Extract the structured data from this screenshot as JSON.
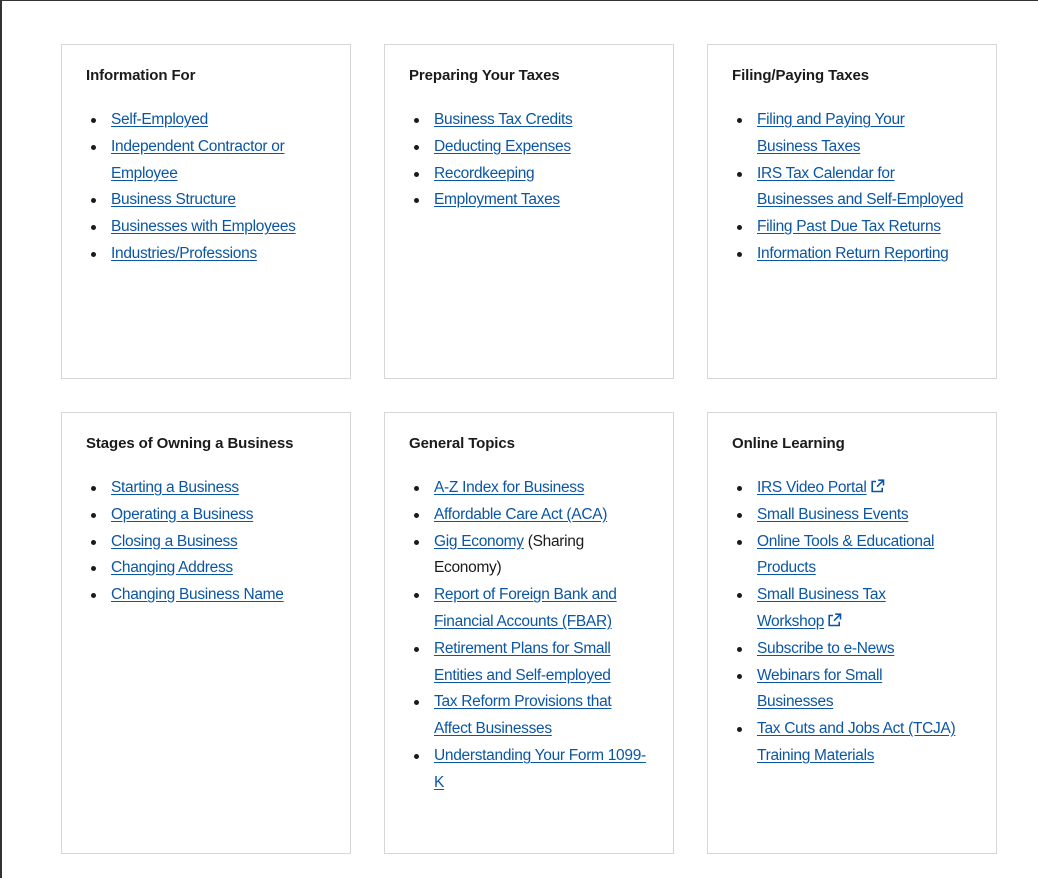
{
  "cards": [
    {
      "title": "Information For",
      "links": [
        "Self-Employed",
        "Independent Contractor or Employee",
        "Business Structure",
        "Businesses with Employees",
        "Industries/Professions"
      ]
    },
    {
      "title": "Preparing Your Taxes",
      "links": [
        "Business Tax Credits",
        "Deducting Expenses",
        "Recordkeeping",
        "Employment Taxes"
      ]
    },
    {
      "title": "Filing/Paying Taxes",
      "links": [
        "Filing and Paying Your Business Taxes",
        "IRS Tax Calendar for Businesses and Self-Employed",
        "Filing Past Due Tax Returns",
        "Information Return Reporting"
      ]
    },
    {
      "title": "Stages of Owning a Business",
      "links": [
        "Starting a Business",
        "Operating a Business",
        "Closing a Business",
        "Changing Address",
        "Changing Business Name"
      ]
    },
    {
      "title": "General Topics",
      "links": [
        "A-Z Index for Business",
        "Affordable Care Act (ACA)",
        "Gig Economy",
        "Report of Foreign Bank and Financial Accounts (FBAR)",
        "Retirement Plans for Small Entities and Self-employed",
        "Tax Reform Provisions that Affect Businesses",
        "Understanding Your Form 1099-K"
      ],
      "gig_suffix": " (Sharing Economy)"
    },
    {
      "title": "Online Learning",
      "links": [
        "IRS Video Portal",
        "Small Business Events",
        "Online Tools & Educational Products",
        "Small Business Tax Workshop",
        "Subscribe to e-News",
        "Webinars for Small Businesses",
        "Tax Cuts and Jobs Act (TCJA) Training Materials"
      ]
    }
  ],
  "icons": {
    "external": "external-link-icon"
  },
  "colors": {
    "link": "#0b56a4",
    "text": "#1b1b1b",
    "card_border": "#d6d6d6"
  }
}
